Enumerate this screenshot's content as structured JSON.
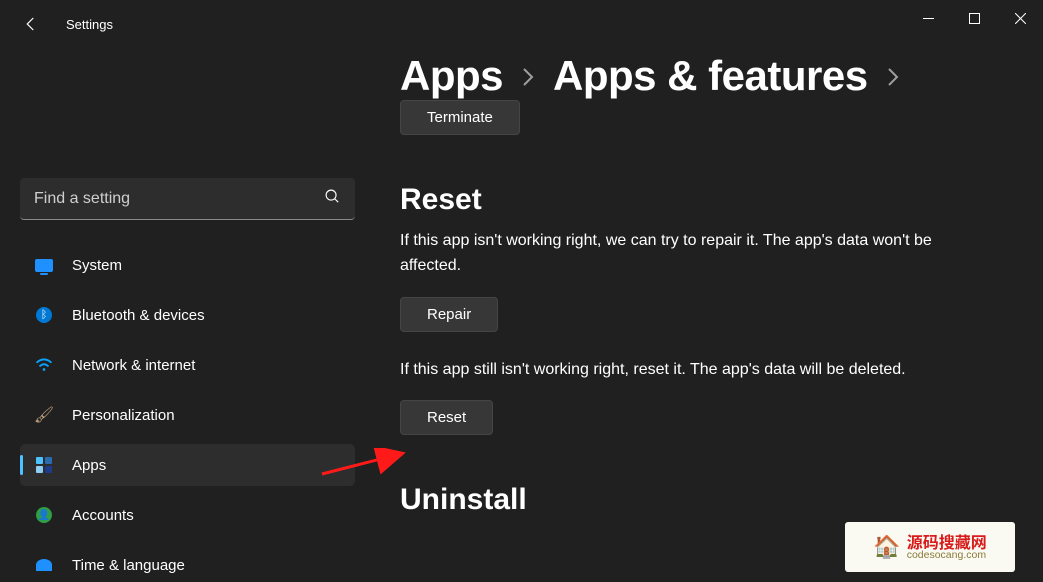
{
  "titlebar": {
    "title": "Settings"
  },
  "search": {
    "placeholder": "Find a setting"
  },
  "sidebar": {
    "items": [
      {
        "label": "System"
      },
      {
        "label": "Bluetooth & devices"
      },
      {
        "label": "Network & internet"
      },
      {
        "label": "Personalization"
      },
      {
        "label": "Apps"
      },
      {
        "label": "Accounts"
      },
      {
        "label": "Time & language"
      }
    ],
    "selected_index": 4
  },
  "breadcrumb": {
    "items": [
      "Apps",
      "Apps & features"
    ]
  },
  "content": {
    "terminate_button": "Terminate",
    "reset_heading": "Reset",
    "repair_desc": "If this app isn't working right, we can try to repair it. The app's data won't be affected.",
    "repair_button": "Repair",
    "reset_desc": "If this app still isn't working right, reset it. The app's data will be deleted.",
    "reset_button": "Reset",
    "uninstall_heading": "Uninstall"
  },
  "watermark": {
    "cn": "源码搜藏网",
    "url": "codesocang.com"
  }
}
